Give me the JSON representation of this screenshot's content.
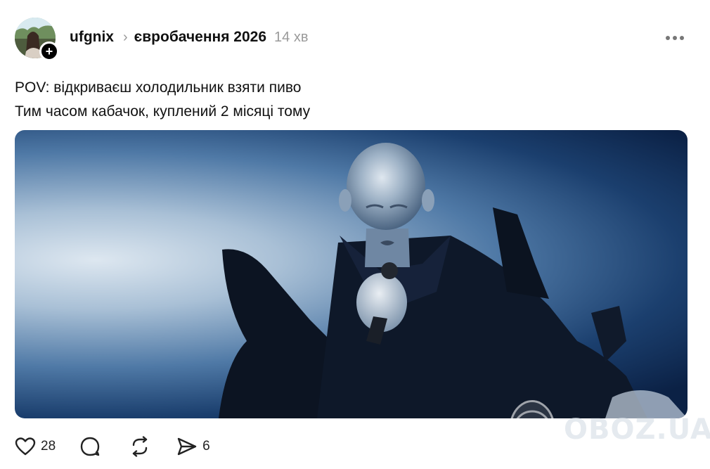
{
  "post": {
    "username": "ufgnix",
    "chevron": "›",
    "topic": "євробачення 2026",
    "time": "14 хв",
    "follow_symbol": "+",
    "text_lines": [
      "POV: відкриваєш холодильник взяти пиво",
      "Тим часом кабачок, куплений 2 місяці тому"
    ]
  },
  "actions": {
    "likes": "28",
    "comments": "",
    "reposts": "",
    "shares": "6"
  },
  "watermark": {
    "text": "OBOZ.UA"
  },
  "icons": {
    "more": "more-horizontal-icon",
    "like": "heart-icon",
    "comment": "comment-icon",
    "repost": "repost-icon",
    "share": "send-icon"
  }
}
